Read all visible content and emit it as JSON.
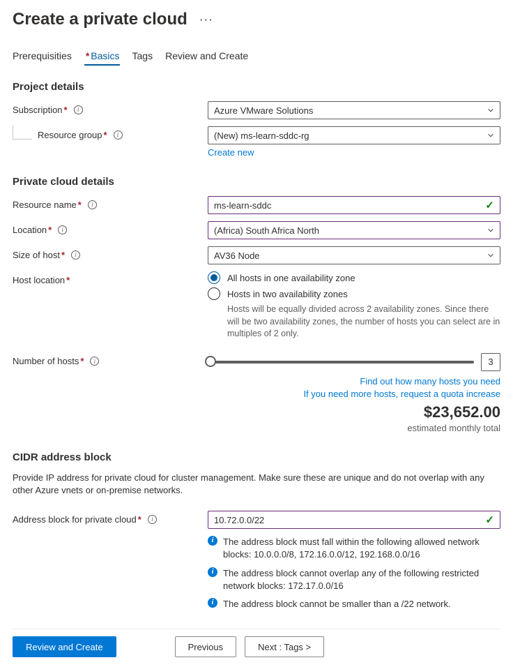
{
  "header": {
    "title": "Create a private cloud"
  },
  "tabs": {
    "prereq": "Prerequisities",
    "basics": "Basics",
    "tags": "Tags",
    "review": "Review and Create"
  },
  "project": {
    "section": "Project details",
    "subscription_label": "Subscription",
    "subscription_value": "Azure VMware Solutions",
    "rg_label": "Resource group",
    "rg_value": "(New) ms-learn-sddc-rg",
    "create_new": "Create new"
  },
  "details": {
    "section": "Private cloud details",
    "resource_name_label": "Resource name",
    "resource_name_value": "ms-learn-sddc",
    "location_label": "Location",
    "location_value": "(Africa) South Africa North",
    "size_label": "Size of host",
    "size_value": "AV36 Node",
    "host_location_label": "Host location",
    "radio_one": "All hosts in one availability zone",
    "radio_two": "Hosts in two availability zones",
    "radio_help": "Hosts will be equally divided across 2 availability zones. Since there will be two availability zones, the number of hosts you can select are in multiples of 2 only.",
    "num_hosts_label": "Number of hosts",
    "num_hosts_value": "3",
    "link_find": "Find out how many hosts you need",
    "link_quota": "If you need more hosts, request a quota increase",
    "price": "$23,652.00",
    "price_sub": "estimated monthly total"
  },
  "cidr": {
    "section": "CIDR address block",
    "desc": "Provide IP address for private cloud for cluster management. Make sure these are unique and do not overlap with any other Azure vnets or on-premise networks.",
    "addr_label": "Address block for private cloud",
    "addr_value": "10.72.0.0/22",
    "info1": "The address block must fall within the following allowed network blocks: 10.0.0.0/8, 172.16.0.0/12, 192.168.0.0/16",
    "info2": "The address block cannot overlap any of the following restricted network blocks: 172.17.0.0/16",
    "info3": "The address block cannot be smaller than a /22 network."
  },
  "footer": {
    "review": "Review and Create",
    "prev": "Previous",
    "next": "Next : Tags >"
  }
}
